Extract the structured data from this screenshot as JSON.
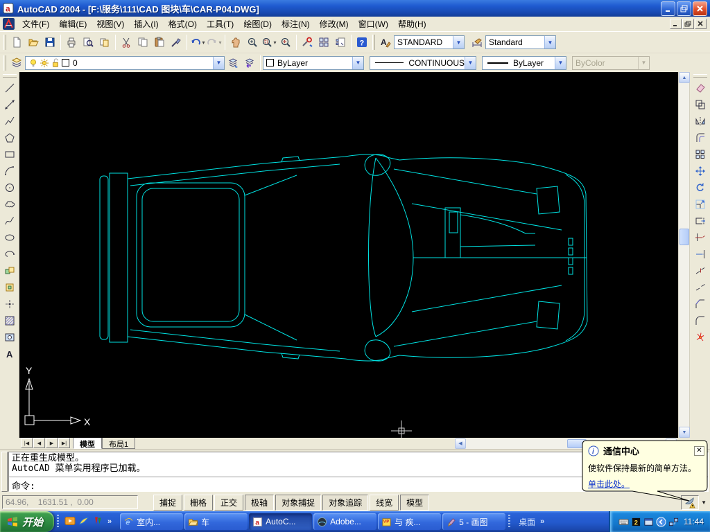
{
  "window": {
    "title": "AutoCAD 2004 - [F:\\服务\\111\\CAD 图块\\车\\CAR-P04.DWG]"
  },
  "menu": {
    "items": [
      "文件(F)",
      "编辑(E)",
      "视图(V)",
      "插入(I)",
      "格式(O)",
      "工具(T)",
      "绘图(D)",
      "标注(N)",
      "修改(M)",
      "窗口(W)",
      "帮助(H)"
    ]
  },
  "toolbars": {
    "standard": {
      "buttons": [
        {
          "icon": "new-file"
        },
        {
          "icon": "open-file"
        },
        {
          "icon": "save"
        },
        {
          "sep": true
        },
        {
          "icon": "print"
        },
        {
          "icon": "print-preview"
        },
        {
          "icon": "publish"
        },
        {
          "sep": true
        },
        {
          "icon": "cut"
        },
        {
          "icon": "copy-clip"
        },
        {
          "icon": "paste"
        },
        {
          "icon": "match-properties"
        },
        {
          "sep": true
        },
        {
          "icon": "undo",
          "dropdown": true
        },
        {
          "icon": "redo",
          "dropdown": true,
          "disabled": true
        },
        {
          "sep": true
        },
        {
          "icon": "pan"
        },
        {
          "icon": "zoom-realtime"
        },
        {
          "icon": "zoom-window",
          "dropdown": true
        },
        {
          "icon": "zoom-previous"
        },
        {
          "sep": true
        },
        {
          "icon": "properties-palette"
        },
        {
          "icon": "designcenter"
        },
        {
          "icon": "tool-palettes"
        },
        {
          "sep": true
        },
        {
          "icon": "help"
        }
      ]
    },
    "styles": {
      "text_style": "STANDARD",
      "dim_style": "Standard"
    },
    "layers": {
      "current_layer": "0"
    },
    "properties": {
      "color": "ByLayer",
      "linetype": "CONTINUOUS",
      "lineweight": "ByLayer",
      "plot_style": "ByColor"
    }
  },
  "draw_toolbar": {
    "buttons": [
      "line",
      "construction-line",
      "polyline",
      "polygon",
      "rectangle",
      "arc",
      "circle",
      "revision-cloud",
      "spline",
      "ellipse",
      "ellipse-arc",
      "insert-block",
      "make-block",
      "point",
      "hatch",
      "region",
      "multiline-text"
    ]
  },
  "modify_toolbar": {
    "buttons": [
      "erase",
      "copy-object",
      "mirror",
      "offset",
      "array",
      "move",
      "rotate",
      "scale",
      "stretch",
      "trim",
      "extend",
      "break-at-point",
      "break",
      "chamfer",
      "fillet",
      "explode"
    ]
  },
  "canvas": {
    "background": "#000000",
    "line_color": "#00e2e2",
    "ucs": {
      "x": "X",
      "y": "Y"
    }
  },
  "sheet_tabs": {
    "tabs": [
      {
        "label": "模型",
        "active": true
      },
      {
        "label": "布局1",
        "active": false
      }
    ]
  },
  "command": {
    "history": [
      "正在重生成模型。",
      "AutoCAD 菜单实用程序已加载。"
    ],
    "prompt": "命令:"
  },
  "status_bar": {
    "coordinates": "64.96,    1631.51 ,  0.00",
    "toggles": [
      {
        "label": "捕捉",
        "pressed": false
      },
      {
        "label": "栅格",
        "pressed": false
      },
      {
        "label": "正交",
        "pressed": false
      },
      {
        "label": "极轴",
        "pressed": true
      },
      {
        "label": "对象捕捉",
        "pressed": true
      },
      {
        "label": "对象追踪",
        "pressed": true
      },
      {
        "label": "线宽",
        "pressed": false
      },
      {
        "label": "模型",
        "pressed": true
      }
    ]
  },
  "balloon": {
    "title": "通信中心",
    "message": "使软件保持最新的简单方法。",
    "link_text": "单击此处。"
  },
  "taskbar": {
    "start_label": "开始",
    "quick_launch_icons": [
      "media-player",
      "swoosh",
      "pens"
    ],
    "tasks": [
      {
        "label": "室内...",
        "icon": "ie",
        "active": false
      },
      {
        "label": "车",
        "icon": "folder",
        "active": false
      },
      {
        "label": "AutoC...",
        "icon": "autocad",
        "active": true
      },
      {
        "label": "Adobe...",
        "icon": "adobe",
        "active": false
      },
      {
        "label": "与 疾...",
        "icon": "vip",
        "active": false
      },
      {
        "label": "5 - 画图",
        "icon": "paint",
        "active": false
      }
    ],
    "desktop_label": "桌面",
    "clock": "11:44"
  }
}
